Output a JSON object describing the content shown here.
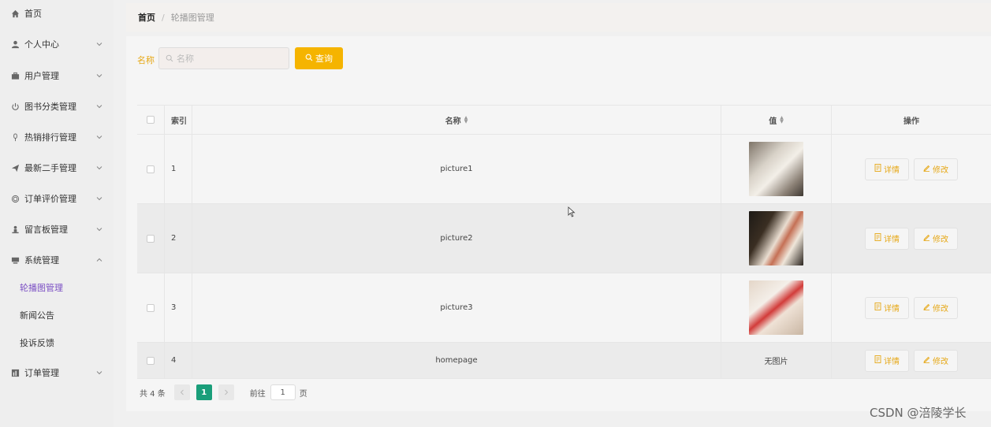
{
  "sidebar": {
    "items": [
      {
        "label": "首页",
        "icon": "home-icon",
        "chevron": ""
      },
      {
        "label": "个人中心",
        "icon": "user-icon",
        "chevron": "down"
      },
      {
        "label": "用户管理",
        "icon": "briefcase-icon",
        "chevron": "down"
      },
      {
        "label": "图书分类管理",
        "icon": "power-icon",
        "chevron": "down"
      },
      {
        "label": "热销排行管理",
        "icon": "microphone-icon",
        "chevron": "down"
      },
      {
        "label": "最新二手管理",
        "icon": "send-icon",
        "chevron": "down"
      },
      {
        "label": "订单评价管理",
        "icon": "circle-icon",
        "chevron": "down"
      },
      {
        "label": "留言板管理",
        "icon": "person-stand-icon",
        "chevron": "down"
      },
      {
        "label": "系统管理",
        "icon": "monitor-icon",
        "chevron": "up"
      },
      {
        "label": "订单管理",
        "icon": "chart-icon",
        "chevron": "down"
      }
    ],
    "sub_items": [
      {
        "label": "轮播图管理",
        "active": true
      },
      {
        "label": "新闻公告",
        "active": false
      },
      {
        "label": "投诉反馈",
        "active": false
      }
    ]
  },
  "breadcrumb": {
    "home": "首页",
    "separator": "/",
    "current": "轮播图管理"
  },
  "search": {
    "label": "名称",
    "placeholder": "名称",
    "button_label": "查询"
  },
  "table": {
    "headers": {
      "index": "索引",
      "name": "名称",
      "value": "值",
      "actions": "操作"
    },
    "rows": [
      {
        "index": "1",
        "name": "picture1",
        "value_type": "image",
        "value_text": ""
      },
      {
        "index": "2",
        "name": "picture2",
        "value_type": "image",
        "value_text": ""
      },
      {
        "index": "3",
        "name": "picture3",
        "value_type": "image",
        "value_text": ""
      },
      {
        "index": "4",
        "name": "homepage",
        "value_type": "text",
        "value_text": "无图片"
      }
    ],
    "detail_label": "详情",
    "edit_label": "修改"
  },
  "pagination": {
    "total": "共 4 条",
    "current_page": "1",
    "goto_label": "前往",
    "goto_value": "1",
    "suffix": "页"
  },
  "colors": {
    "accent": "#f5b400",
    "active_page": "#1a9e7a",
    "active_menu": "#7b4fc4"
  },
  "watermark": "CSDN @涪陵学长"
}
